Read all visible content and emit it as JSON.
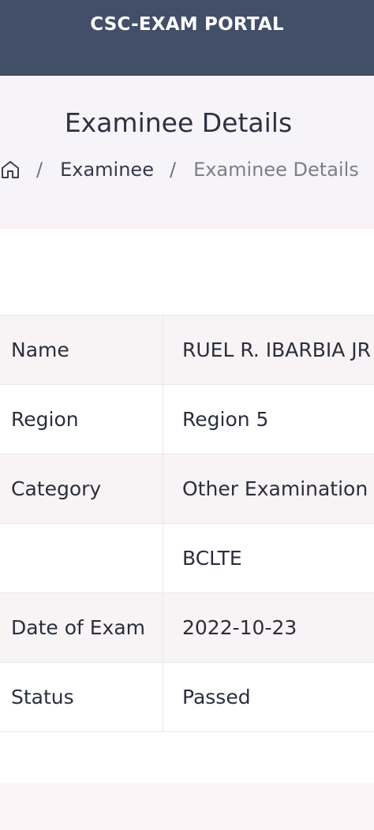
{
  "header": {
    "title": "CSC-EXAM PORTAL"
  },
  "page": {
    "title": "Examinee Details"
  },
  "breadcrumb": {
    "home_icon": "home-icon",
    "separator": "/",
    "items": [
      "Examinee",
      "Examinee Details"
    ]
  },
  "details": [
    {
      "label": "Name",
      "value": "RUEL R. IBARBIA JR"
    },
    {
      "label": "Region",
      "value": "Region 5"
    },
    {
      "label": "Category",
      "value": "Other Examination"
    },
    {
      "label": "",
      "value": "BCLTE"
    },
    {
      "label": "Date of Exam",
      "value": "2022-10-23"
    },
    {
      "label": "Status",
      "value": "Passed"
    }
  ],
  "colors": {
    "header_bg": "#434e69",
    "section_bg": "#f6f4f8",
    "row_shade": "#f8f4f6"
  }
}
